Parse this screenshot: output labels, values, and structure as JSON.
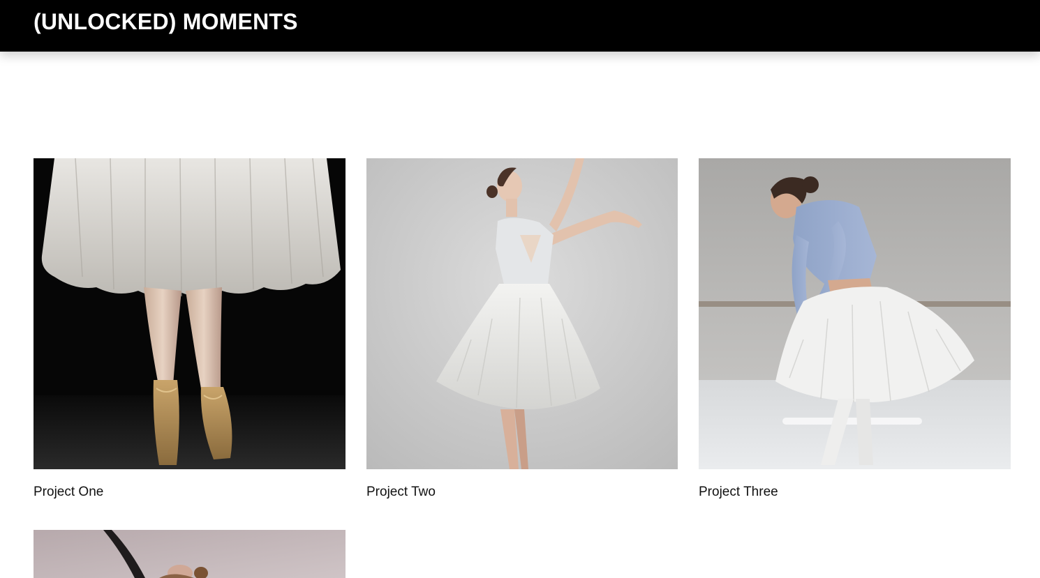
{
  "header": {
    "site_title": "(UNLOCKED) MOMENTS"
  },
  "projects": [
    {
      "title": "Project One",
      "image": "ballerina-pointe-shoes-photo"
    },
    {
      "title": "Project Two",
      "image": "ballerina-white-tutu-photo"
    },
    {
      "title": "Project Three",
      "image": "ballerina-blue-top-studio-photo"
    },
    {
      "title": "",
      "image": "ballerina-stretch-photo"
    }
  ],
  "colors": {
    "header_bg": "#000000",
    "header_text": "#ffffff",
    "page_bg": "#ffffff",
    "caption_text": "#111111"
  }
}
